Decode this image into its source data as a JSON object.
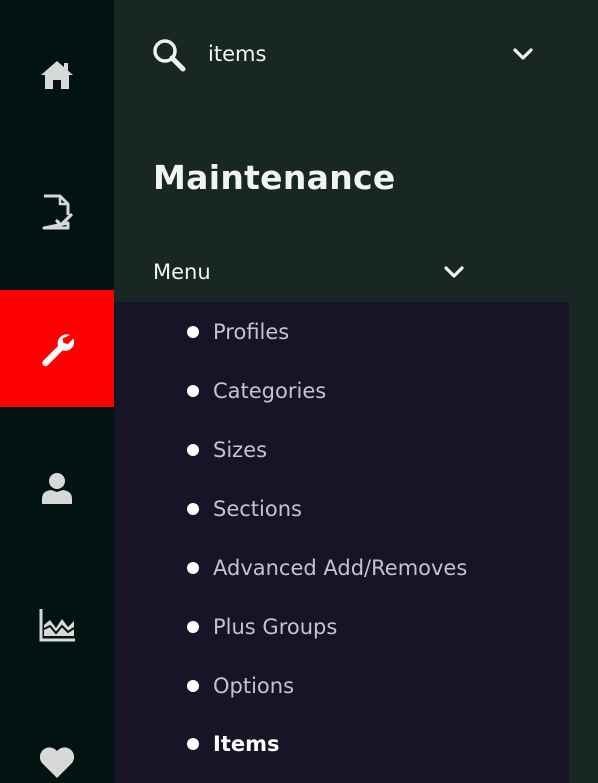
{
  "rail": {
    "items": [
      {
        "icon": "home-icon"
      },
      {
        "icon": "document-check-icon"
      },
      {
        "icon": "wrench-icon",
        "active": true
      },
      {
        "icon": "user-icon"
      },
      {
        "icon": "area-chart-icon"
      },
      {
        "icon": "heart-icon"
      }
    ],
    "active_color": "#ff0000"
  },
  "search": {
    "icon": "search-icon",
    "value": "items",
    "chevron": "chevron-down-icon"
  },
  "section": {
    "title": "Maintenance"
  },
  "menu": {
    "label": "Menu",
    "chevron": "chevron-down-icon",
    "items": [
      {
        "label": "Profiles"
      },
      {
        "label": "Categories"
      },
      {
        "label": "Sizes"
      },
      {
        "label": "Sections"
      },
      {
        "label": "Advanced Add/Removes"
      },
      {
        "label": "Plus Groups"
      },
      {
        "label": "Options"
      },
      {
        "label": "Items",
        "active": true
      }
    ]
  },
  "colors": {
    "rail_bg": "#031311",
    "panel_bg": "#182624",
    "submenu_bg": "#171427",
    "text": "#f2f4f3",
    "muted_text": "#c2c6cb"
  }
}
